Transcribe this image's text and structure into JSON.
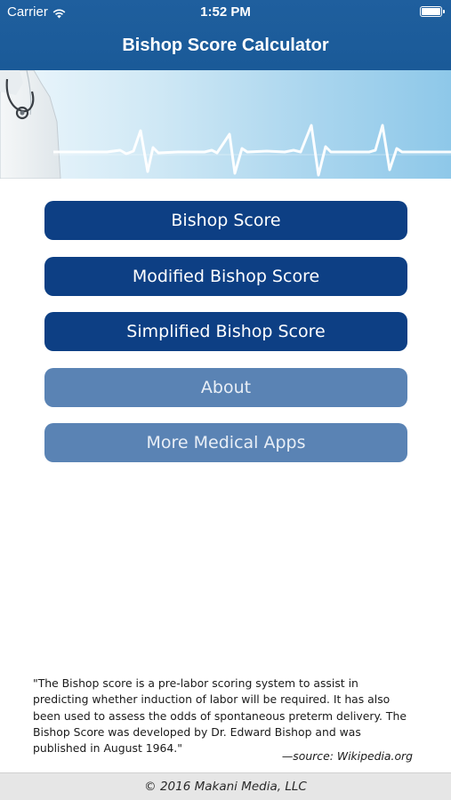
{
  "status_bar": {
    "carrier": "Carrier",
    "time": "1:52 PM",
    "icons": [
      "wifi-icon",
      "battery-icon"
    ]
  },
  "nav": {
    "title": "Bishop Score Calculator"
  },
  "banner": {
    "image": "doctor-with-stethoscope-and-heartbeat-line"
  },
  "menu": {
    "items": [
      {
        "label": "Bishop Score",
        "style": "primary"
      },
      {
        "label": "Modified Bishop Score",
        "style": "primary"
      },
      {
        "label": "Simplified Bishop Score",
        "style": "primary"
      },
      {
        "label": "About",
        "style": "secondary"
      },
      {
        "label": "More Medical Apps",
        "style": "secondary"
      }
    ]
  },
  "quote": {
    "text": "\"The Bishop score is a pre-labor scoring system to assist in predicting whether induction of labor will be required. It has also been used to assess the odds of spontaneous preterm delivery. The Bishop Score was developed by Dr. Edward Bishop and was published in August 1964.\"",
    "source": "—source: Wikipedia.org"
  },
  "footer": {
    "copyright": "© 2016 Makani Media, LLC"
  },
  "colors": {
    "nav_bar": "#1f5f9e",
    "button_primary": "#0d3f84",
    "button_secondary": "#5a83b4",
    "footer_bg": "#e6e6e6"
  }
}
